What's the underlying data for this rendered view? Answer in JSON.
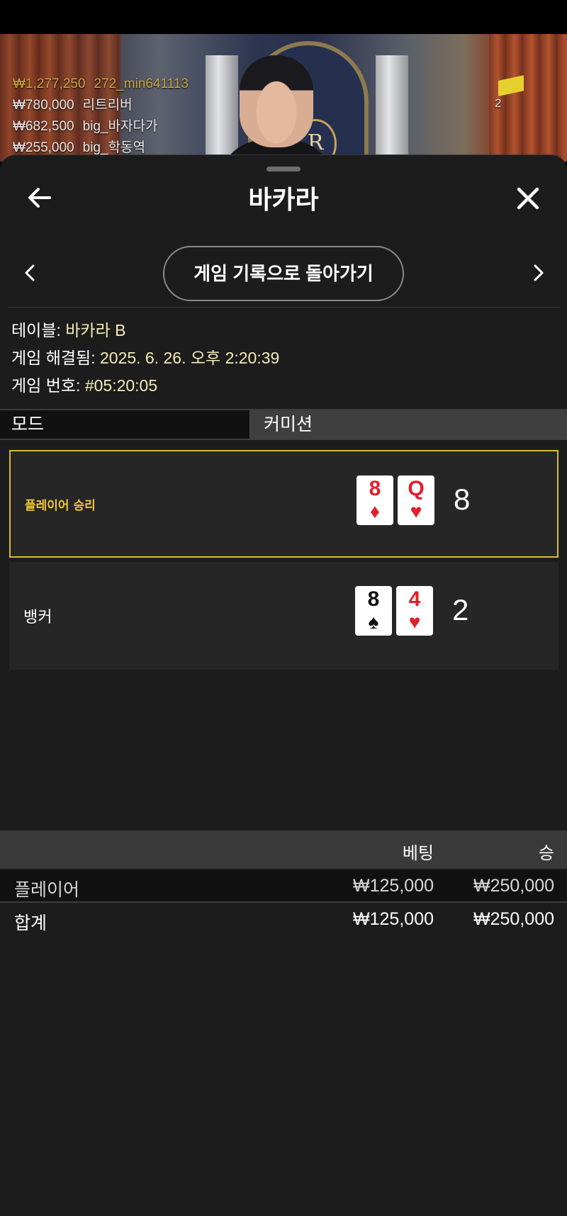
{
  "stream": {
    "leaderboard": [
      {
        "amount": "₩1,277,250",
        "name": "272_min641113"
      },
      {
        "amount": "₩780,000",
        "name": "리트리버"
      },
      {
        "amount": "₩682,500",
        "name": "big_바자다가"
      },
      {
        "amount": "₩255,000",
        "name": "big_학동역"
      }
    ],
    "viewer_count": "2",
    "crest_letter": "R"
  },
  "header": {
    "title": "바카라",
    "back_icon": "arrow-left-icon",
    "close_icon": "close-icon"
  },
  "nav": {
    "back_to_history": "게임 기록으로 돌아가기"
  },
  "info": {
    "table_label": "테이블:",
    "table_value": "바카라 B",
    "resolved_label": "게임 해결됨:",
    "resolved_value": "2025. 6. 26. 오후 2:20:39",
    "number_label": "게임 번호:",
    "number_value": "#05:20:05"
  },
  "mode": {
    "label": "모드",
    "value": "커미션"
  },
  "results": {
    "player": {
      "label": "플레이어 승리",
      "cards": [
        {
          "rank": "8",
          "suit": "♦"
        },
        {
          "rank": "Q",
          "suit": "♥"
        }
      ],
      "score": "8"
    },
    "banker": {
      "label": "뱅커",
      "cards": [
        {
          "rank": "8",
          "suit": "♠"
        },
        {
          "rank": "4",
          "suit": "♥"
        }
      ],
      "score": "2"
    }
  },
  "bets": {
    "headers": {
      "bet": "베팅",
      "win": "승"
    },
    "rows": [
      {
        "name": "플레이어",
        "bet": "₩125,000",
        "win": "₩250,000"
      }
    ],
    "total": {
      "name": "합계",
      "bet": "₩125,000",
      "win": "₩250,000"
    }
  },
  "colors": {
    "accent": "#d9bd2a",
    "card_red": "#e11f2b",
    "sheet_bg": "#1c1c1c"
  }
}
